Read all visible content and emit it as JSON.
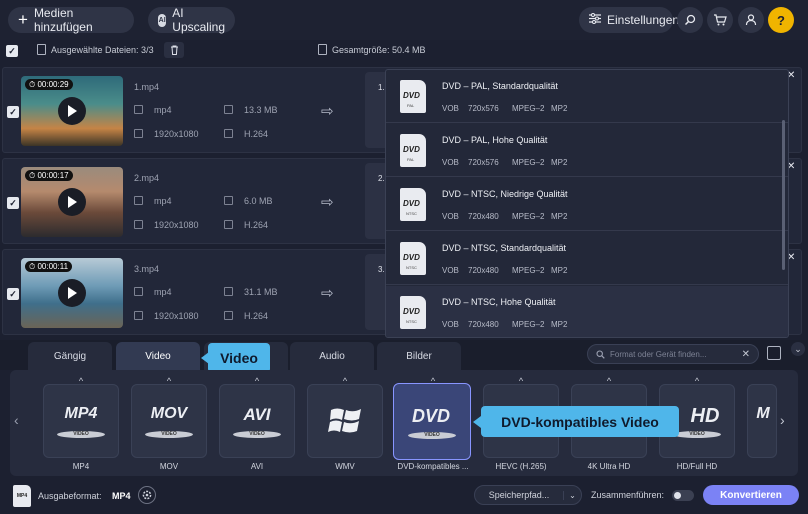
{
  "topbar": {
    "add_media_label": "Medien hinzufügen",
    "ai_upscaling_label": "AI Upscaling",
    "settings_label": "Einstellungen",
    "help_label": "?"
  },
  "selection": {
    "selected_label": "Ausgewählte Dateien: 3/3",
    "total_size_label": "Gesamtgröße: 50.4 MB"
  },
  "files": [
    {
      "duration": "00:00:29",
      "name": "1.mp4",
      "container": "mp4",
      "size": "13.3 MB",
      "resolution": "1920x1080",
      "codec": "H.264",
      "output_prefix": "1."
    },
    {
      "duration": "00:00:17",
      "name": "2.mp4",
      "container": "mp4",
      "size": "6.0 MB",
      "resolution": "1920x1080",
      "codec": "H.264",
      "output_prefix": "2."
    },
    {
      "duration": "00:00:11",
      "name": "3.mp4",
      "container": "mp4",
      "size": "31.1 MB",
      "resolution": "1920x1080",
      "codec": "H.264",
      "output_prefix": "3."
    }
  ],
  "presets": [
    {
      "title": "DVD – PAL, Standardqualität",
      "container": "VOB",
      "resolution": "720x576",
      "codec": "MPEG–2",
      "audio": "MP2",
      "badge": "PAL"
    },
    {
      "title": "DVD – PAL, Hohe Qualität",
      "container": "VOB",
      "resolution": "720x576",
      "codec": "MPEG–2",
      "audio": "MP2",
      "badge": "PAL"
    },
    {
      "title": "DVD – NTSC, Niedrige Qualität",
      "container": "VOB",
      "resolution": "720x480",
      "codec": "MPEG–2",
      "audio": "MP2",
      "badge": "NTSC"
    },
    {
      "title": "DVD – NTSC, Standardqualität",
      "container": "VOB",
      "resolution": "720x480",
      "codec": "MPEG–2",
      "audio": "MP2",
      "badge": "NTSC"
    },
    {
      "title": "DVD – NTSC, Hohe Qualität",
      "container": "VOB",
      "resolution": "720x480",
      "codec": "MPEG–2",
      "audio": "MP2",
      "badge": "NTSC"
    }
  ],
  "tabs": {
    "popular": "Gängig",
    "video": "Video",
    "audio": "Audio",
    "images": "Bilder"
  },
  "search": {
    "placeholder": "Format oder Gerät finden..."
  },
  "callouts": {
    "video": "Video",
    "dvd": "DVD-kompatibles Video"
  },
  "formats": [
    {
      "logo": "MP4",
      "sub": "VIDEO",
      "label": "MP4"
    },
    {
      "logo": "MOV",
      "sub": "VIDEO",
      "label": "MOV"
    },
    {
      "logo": "AVI",
      "sub": "VIDEO",
      "label": "AVI"
    },
    {
      "logo": "",
      "sub": "",
      "label": "WMV"
    },
    {
      "logo": "DVD",
      "sub": "VIDEO",
      "label": "DVD-kompatibles ..."
    },
    {
      "logo": "",
      "sub": "",
      "label": "HEVC (H.265)"
    },
    {
      "logo": "",
      "sub": "",
      "label": "4K Ultra HD"
    },
    {
      "logo": "HD",
      "sub": "VIDEO",
      "label": "HD/Full HD"
    },
    {
      "logo": "M",
      "sub": "",
      "label": ""
    }
  ],
  "bottom": {
    "output_format_label": "Ausgabeformat:",
    "output_format_value": "MP4",
    "save_path_label": "Speicherpfad...",
    "merge_label": "Zusammenführen:",
    "convert_label": "Konvertieren",
    "format_icon_text": "MP4"
  },
  "colors": {
    "accent": "#7b82f5",
    "callout": "#4fb6ea",
    "help": "#f0b400"
  }
}
